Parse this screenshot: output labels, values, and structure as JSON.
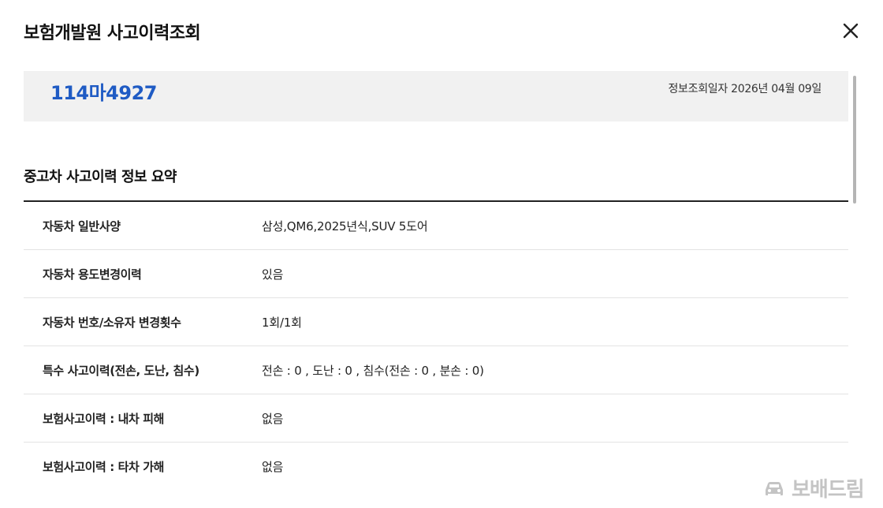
{
  "modal": {
    "title": "보험개발원 사고이력조회",
    "close_icon": "close-icon"
  },
  "vehicle": {
    "plate_number": "114마4927",
    "query_date": "정보조회일자 2026년 04월 09일"
  },
  "summary": {
    "title": "중고차 사고이력 정보 요약",
    "rows": [
      {
        "label": "자동차 일반사양",
        "value": "삼성,QM6,2025년식,SUV 5도어"
      },
      {
        "label": "자동차 용도변경이력",
        "value": "있음"
      },
      {
        "label": "자동차 번호/소유자 변경횟수",
        "value": "1회/1회"
      },
      {
        "label": "특수 사고이력(전손, 도난, 침수)",
        "value": "전손 : 0 , 도난 : 0 , 침수(전손 : 0 , 분손 : 0)"
      },
      {
        "label": "보험사고이력 : 내차 피해",
        "value": "없음"
      },
      {
        "label": "보험사고이력 : 타차 가해",
        "value": "없음"
      }
    ]
  },
  "watermark": {
    "text": "보배드림",
    "icon": "bobaedream-logo-icon"
  },
  "colors": {
    "plate_number": "#1f5bc4",
    "plate_box_bg": "#f1f1f1",
    "table_top_border": "#222222",
    "row_divider": "#e3e3e3",
    "watermark": "#c4c4c4"
  }
}
